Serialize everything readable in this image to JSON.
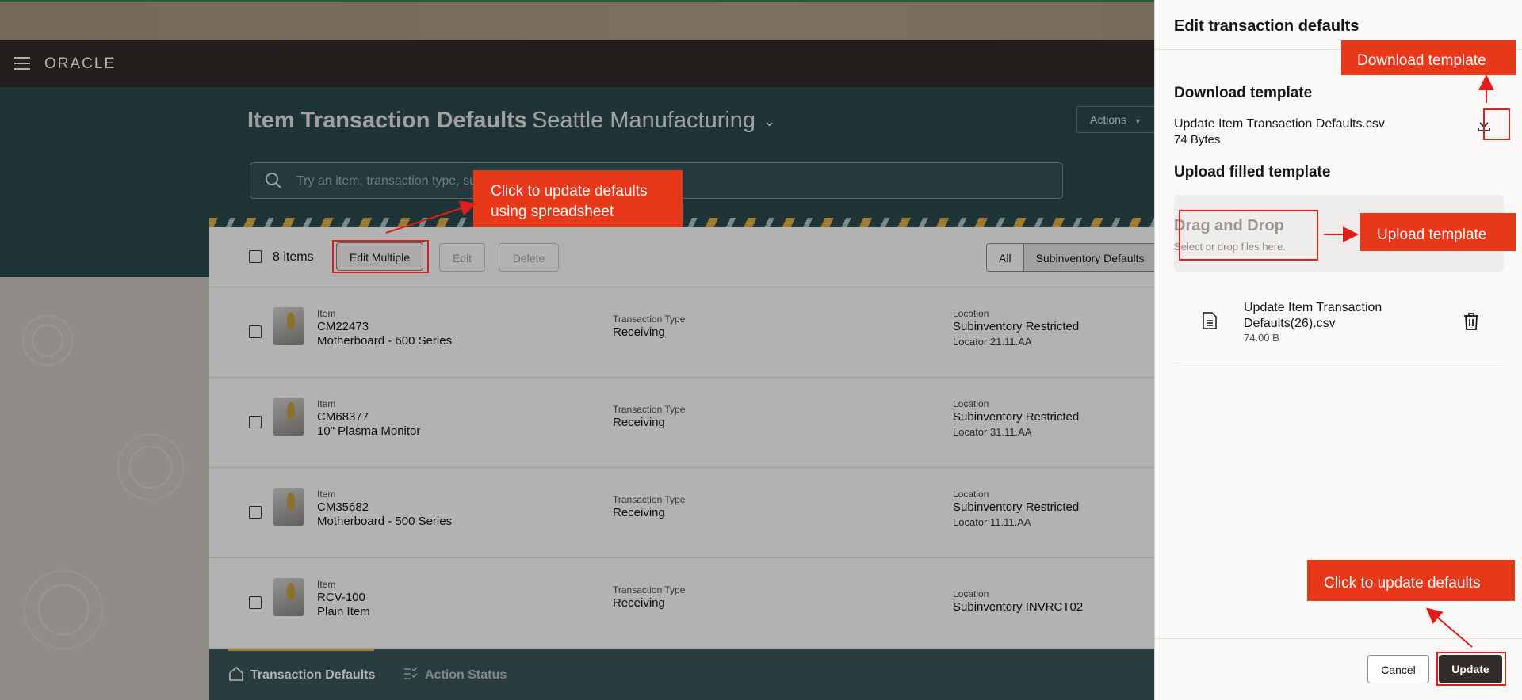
{
  "brand": {
    "logo_text": "ORACLE"
  },
  "header": {
    "title_bold": "Item Transaction Defaults",
    "title_org": "Seattle Manufacturing",
    "actions_label": "Actions",
    "search_placeholder": "Try an item, transaction type, su"
  },
  "toolbar": {
    "item_count": "8 items",
    "edit_multiple_label": "Edit Multiple",
    "edit_label": "Edit",
    "delete_label": "Delete",
    "filter_all": "All",
    "filter_subinventory": "Subinventory Defaults"
  },
  "rows": [
    {
      "item_label": "Item",
      "item_code": "CM22473",
      "item_desc": "Motherboard - 600 Series",
      "type_label": "Transaction Type",
      "type_value": "Receiving",
      "loc_label": "Location",
      "loc_value": "Subinventory Restricted",
      "locator": "Locator 21.11.AA"
    },
    {
      "item_label": "Item",
      "item_code": "CM68377",
      "item_desc": "10\" Plasma Monitor",
      "type_label": "Transaction Type",
      "type_value": "Receiving",
      "loc_label": "Location",
      "loc_value": "Subinventory Restricted",
      "locator": "Locator 31.11.AA"
    },
    {
      "item_label": "Item",
      "item_code": "CM35682",
      "item_desc": "Motherboard - 500 Series",
      "type_label": "Transaction Type",
      "type_value": "Receiving",
      "loc_label": "Location",
      "loc_value": "Subinventory Restricted",
      "locator": "Locator 11.11.AA"
    },
    {
      "item_label": "Item",
      "item_code": "RCV-100",
      "item_desc": "Plain Item",
      "type_label": "Transaction Type",
      "type_value": "Receiving",
      "loc_label": "Location",
      "loc_value": "Subinventory INVRCT02",
      "locator": ""
    }
  ],
  "bottom_nav": {
    "tab_defaults": "Transaction Defaults",
    "tab_status": "Action Status"
  },
  "drawer": {
    "title": "Edit transaction defaults",
    "download_heading": "Download template",
    "template_file": "Update Item Transaction Defaults.csv",
    "template_size": "74 Bytes",
    "upload_heading": "Upload filled template",
    "dropzone_title": "Drag and Drop",
    "dropzone_sub": "Select or drop files here.",
    "uploaded_file": "Update Item Transaction Defaults(26).csv",
    "uploaded_size": "74.00 B",
    "cancel_label": "Cancel",
    "update_label": "Update"
  },
  "annotations": {
    "edit_multiple_line1": "Click to update defaults",
    "edit_multiple_line2": "using spreadsheet",
    "download": "Download template",
    "upload": "Upload template",
    "update": "Click to update defaults"
  },
  "colors": {
    "callout": "#e8381a",
    "highlight": "#e21b1b",
    "header_teal": "#2d4b50",
    "brand_bar": "#312d2a"
  },
  "icons": [
    "menu-icon",
    "chevron-down-icon",
    "search-icon",
    "download-icon",
    "file-icon",
    "trash-icon",
    "home-icon",
    "checklist-icon"
  ]
}
